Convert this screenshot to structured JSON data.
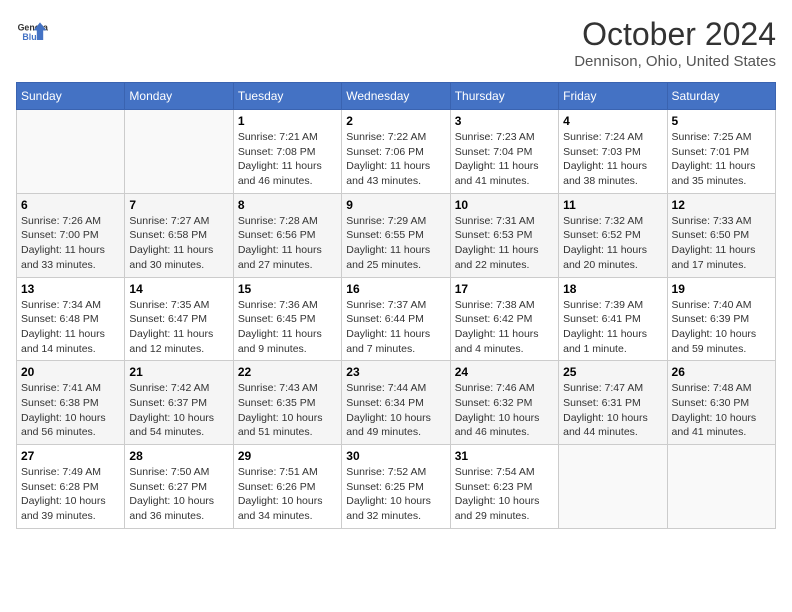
{
  "header": {
    "logo_line1": "General",
    "logo_line2": "Blue",
    "title": "October 2024",
    "subtitle": "Dennison, Ohio, United States"
  },
  "days_of_week": [
    "Sunday",
    "Monday",
    "Tuesday",
    "Wednesday",
    "Thursday",
    "Friday",
    "Saturday"
  ],
  "weeks": [
    [
      {
        "day": "",
        "sunrise": "",
        "sunset": "",
        "daylight": ""
      },
      {
        "day": "",
        "sunrise": "",
        "sunset": "",
        "daylight": ""
      },
      {
        "day": "1",
        "sunrise": "Sunrise: 7:21 AM",
        "sunset": "Sunset: 7:08 PM",
        "daylight": "Daylight: 11 hours and 46 minutes."
      },
      {
        "day": "2",
        "sunrise": "Sunrise: 7:22 AM",
        "sunset": "Sunset: 7:06 PM",
        "daylight": "Daylight: 11 hours and 43 minutes."
      },
      {
        "day": "3",
        "sunrise": "Sunrise: 7:23 AM",
        "sunset": "Sunset: 7:04 PM",
        "daylight": "Daylight: 11 hours and 41 minutes."
      },
      {
        "day": "4",
        "sunrise": "Sunrise: 7:24 AM",
        "sunset": "Sunset: 7:03 PM",
        "daylight": "Daylight: 11 hours and 38 minutes."
      },
      {
        "day": "5",
        "sunrise": "Sunrise: 7:25 AM",
        "sunset": "Sunset: 7:01 PM",
        "daylight": "Daylight: 11 hours and 35 minutes."
      }
    ],
    [
      {
        "day": "6",
        "sunrise": "Sunrise: 7:26 AM",
        "sunset": "Sunset: 7:00 PM",
        "daylight": "Daylight: 11 hours and 33 minutes."
      },
      {
        "day": "7",
        "sunrise": "Sunrise: 7:27 AM",
        "sunset": "Sunset: 6:58 PM",
        "daylight": "Daylight: 11 hours and 30 minutes."
      },
      {
        "day": "8",
        "sunrise": "Sunrise: 7:28 AM",
        "sunset": "Sunset: 6:56 PM",
        "daylight": "Daylight: 11 hours and 27 minutes."
      },
      {
        "day": "9",
        "sunrise": "Sunrise: 7:29 AM",
        "sunset": "Sunset: 6:55 PM",
        "daylight": "Daylight: 11 hours and 25 minutes."
      },
      {
        "day": "10",
        "sunrise": "Sunrise: 7:31 AM",
        "sunset": "Sunset: 6:53 PM",
        "daylight": "Daylight: 11 hours and 22 minutes."
      },
      {
        "day": "11",
        "sunrise": "Sunrise: 7:32 AM",
        "sunset": "Sunset: 6:52 PM",
        "daylight": "Daylight: 11 hours and 20 minutes."
      },
      {
        "day": "12",
        "sunrise": "Sunrise: 7:33 AM",
        "sunset": "Sunset: 6:50 PM",
        "daylight": "Daylight: 11 hours and 17 minutes."
      }
    ],
    [
      {
        "day": "13",
        "sunrise": "Sunrise: 7:34 AM",
        "sunset": "Sunset: 6:48 PM",
        "daylight": "Daylight: 11 hours and 14 minutes."
      },
      {
        "day": "14",
        "sunrise": "Sunrise: 7:35 AM",
        "sunset": "Sunset: 6:47 PM",
        "daylight": "Daylight: 11 hours and 12 minutes."
      },
      {
        "day": "15",
        "sunrise": "Sunrise: 7:36 AM",
        "sunset": "Sunset: 6:45 PM",
        "daylight": "Daylight: 11 hours and 9 minutes."
      },
      {
        "day": "16",
        "sunrise": "Sunrise: 7:37 AM",
        "sunset": "Sunset: 6:44 PM",
        "daylight": "Daylight: 11 hours and 7 minutes."
      },
      {
        "day": "17",
        "sunrise": "Sunrise: 7:38 AM",
        "sunset": "Sunset: 6:42 PM",
        "daylight": "Daylight: 11 hours and 4 minutes."
      },
      {
        "day": "18",
        "sunrise": "Sunrise: 7:39 AM",
        "sunset": "Sunset: 6:41 PM",
        "daylight": "Daylight: 11 hours and 1 minute."
      },
      {
        "day": "19",
        "sunrise": "Sunrise: 7:40 AM",
        "sunset": "Sunset: 6:39 PM",
        "daylight": "Daylight: 10 hours and 59 minutes."
      }
    ],
    [
      {
        "day": "20",
        "sunrise": "Sunrise: 7:41 AM",
        "sunset": "Sunset: 6:38 PM",
        "daylight": "Daylight: 10 hours and 56 minutes."
      },
      {
        "day": "21",
        "sunrise": "Sunrise: 7:42 AM",
        "sunset": "Sunset: 6:37 PM",
        "daylight": "Daylight: 10 hours and 54 minutes."
      },
      {
        "day": "22",
        "sunrise": "Sunrise: 7:43 AM",
        "sunset": "Sunset: 6:35 PM",
        "daylight": "Daylight: 10 hours and 51 minutes."
      },
      {
        "day": "23",
        "sunrise": "Sunrise: 7:44 AM",
        "sunset": "Sunset: 6:34 PM",
        "daylight": "Daylight: 10 hours and 49 minutes."
      },
      {
        "day": "24",
        "sunrise": "Sunrise: 7:46 AM",
        "sunset": "Sunset: 6:32 PM",
        "daylight": "Daylight: 10 hours and 46 minutes."
      },
      {
        "day": "25",
        "sunrise": "Sunrise: 7:47 AM",
        "sunset": "Sunset: 6:31 PM",
        "daylight": "Daylight: 10 hours and 44 minutes."
      },
      {
        "day": "26",
        "sunrise": "Sunrise: 7:48 AM",
        "sunset": "Sunset: 6:30 PM",
        "daylight": "Daylight: 10 hours and 41 minutes."
      }
    ],
    [
      {
        "day": "27",
        "sunrise": "Sunrise: 7:49 AM",
        "sunset": "Sunset: 6:28 PM",
        "daylight": "Daylight: 10 hours and 39 minutes."
      },
      {
        "day": "28",
        "sunrise": "Sunrise: 7:50 AM",
        "sunset": "Sunset: 6:27 PM",
        "daylight": "Daylight: 10 hours and 36 minutes."
      },
      {
        "day": "29",
        "sunrise": "Sunrise: 7:51 AM",
        "sunset": "Sunset: 6:26 PM",
        "daylight": "Daylight: 10 hours and 34 minutes."
      },
      {
        "day": "30",
        "sunrise": "Sunrise: 7:52 AM",
        "sunset": "Sunset: 6:25 PM",
        "daylight": "Daylight: 10 hours and 32 minutes."
      },
      {
        "day": "31",
        "sunrise": "Sunrise: 7:54 AM",
        "sunset": "Sunset: 6:23 PM",
        "daylight": "Daylight: 10 hours and 29 minutes."
      },
      {
        "day": "",
        "sunrise": "",
        "sunset": "",
        "daylight": ""
      },
      {
        "day": "",
        "sunrise": "",
        "sunset": "",
        "daylight": ""
      }
    ]
  ]
}
